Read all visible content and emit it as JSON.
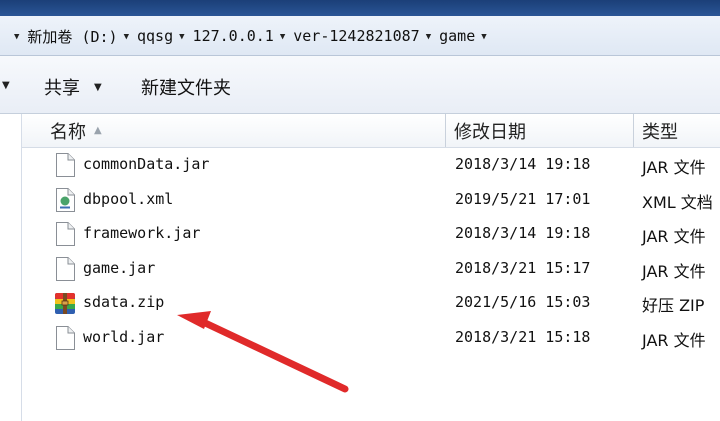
{
  "address": {
    "crumbs": [
      "新加卷 (D:)",
      "qqsg",
      "127.0.0.1",
      "ver-1242821087",
      "game"
    ]
  },
  "toolbar": {
    "share_label": "共享",
    "new_folder_label": "新建文件夹"
  },
  "columns": {
    "name": "名称",
    "date": "修改日期",
    "type": "类型"
  },
  "files": [
    {
      "name": "commonData.jar",
      "date": "2018/3/14 19:18",
      "type": "JAR 文件",
      "icon": "jar-file-icon"
    },
    {
      "name": "dbpool.xml",
      "date": "2019/5/21 17:01",
      "type": "XML 文档",
      "icon": "xml-file-icon"
    },
    {
      "name": "framework.jar",
      "date": "2018/3/14 19:18",
      "type": "JAR 文件",
      "icon": "jar-file-icon"
    },
    {
      "name": "game.jar",
      "date": "2018/3/21 15:17",
      "type": "JAR 文件",
      "icon": "jar-file-icon"
    },
    {
      "name": "sdata.zip",
      "date": "2021/5/16 15:03",
      "type": "好压 ZIP",
      "icon": "zip-archive-icon"
    },
    {
      "name": "world.jar",
      "date": "2018/3/21 15:18",
      "type": "JAR 文件",
      "icon": "jar-file-icon"
    }
  ],
  "colors": {
    "annotation_arrow": "#e02a2a",
    "title_bar": "#1b3f78"
  }
}
